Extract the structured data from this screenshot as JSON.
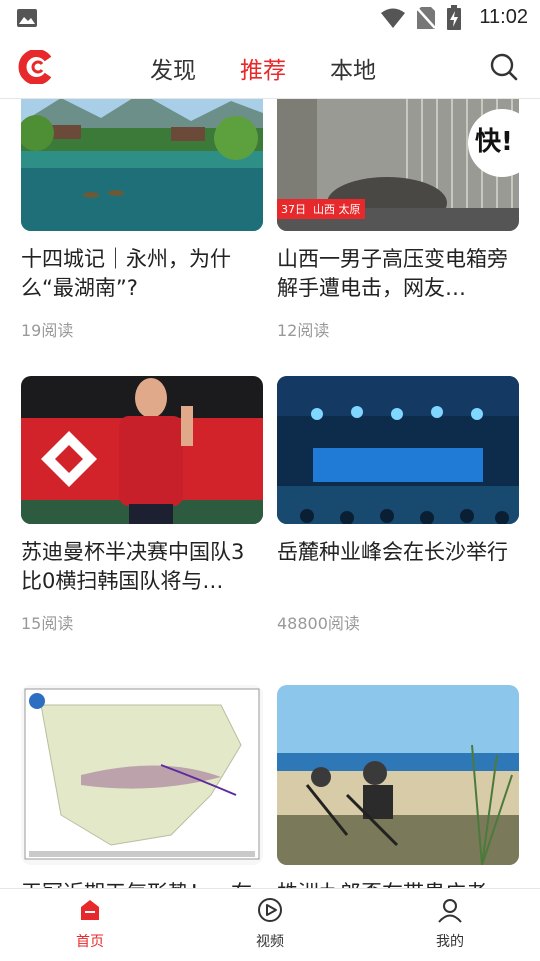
{
  "status": {
    "time": "11:02"
  },
  "header": {
    "tabs": [
      {
        "label": "发现"
      },
      {
        "label": "推荐"
      },
      {
        "label": "本地"
      }
    ],
    "active_tab": "推荐"
  },
  "feed": {
    "items": [
      {
        "title": "十四城记｜永州，为什么“最湖南”?",
        "reads": "19阅读"
      },
      {
        "title": "山西一男子高压变电箱旁解手遭电击，网友…",
        "reads": "12阅读",
        "image_caption": "山西 太原",
        "image_text": "快!",
        "image_date": "37日"
      },
      {
        "title": "苏迪曼杯半决赛中国队3比0横扫韩国队将与…",
        "reads": "15阅读"
      },
      {
        "title": "岳麓种业峰会在长沙举行",
        "reads": "48800阅读"
      },
      {
        "title": "王冠近期天气形势！一布",
        "reads": ""
      },
      {
        "title": "株洲九郎歪在带患广者",
        "reads": ""
      }
    ]
  },
  "bottom_nav": {
    "items": [
      {
        "label": "首页",
        "icon": "home-icon"
      },
      {
        "label": "视频",
        "icon": "play-icon"
      },
      {
        "label": "我的",
        "icon": "profile-icon"
      }
    ],
    "active": "首页"
  },
  "colors": {
    "accent": "#e8292b",
    "text": "#222222",
    "muted": "#999999"
  }
}
